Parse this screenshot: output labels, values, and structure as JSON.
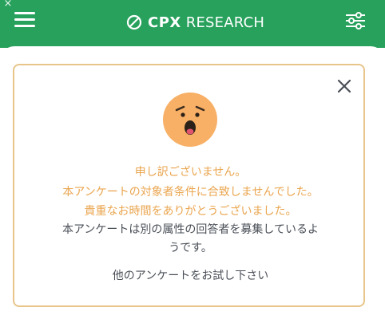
{
  "header": {
    "brand_bold": "CPX",
    "brand_light": "RESEARCH",
    "menu_icon": "hamburger-menu-icon",
    "settings_icon": "sliders-settings-icon",
    "corner_close": "×",
    "background_color": "#27a15c"
  },
  "card": {
    "border_color": "#e8c58a",
    "close_icon": "close-icon",
    "emoji": "astonished-face-icon",
    "messages": {
      "line1": "申し訳ございません。",
      "line2": "本アンケートの対象者条件に合致しませんでした。",
      "line3": "貴重なお時間をありがとうございました。",
      "line4": "本アンケートは別の属性の回答者を募集しているよ",
      "line5": "うです。",
      "line6": "他のアンケートをお試し下さい"
    },
    "colors": {
      "highlight_text": "#eaa54f",
      "body_text": "#4a4f57"
    }
  }
}
